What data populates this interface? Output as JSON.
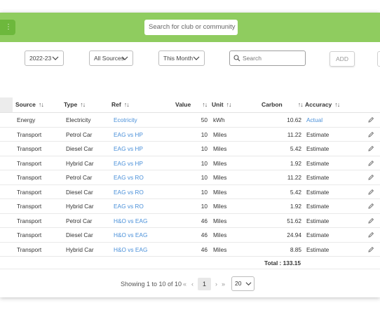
{
  "topbar": {
    "menu_label": "⋮",
    "club_search_placeholder": "Search for club or community"
  },
  "filters": {
    "year": "2022-23",
    "sources": "All Sources",
    "period": "This Month",
    "search_placeholder": "Search",
    "add_label": "ADD"
  },
  "table": {
    "headers": {
      "source": "Source",
      "type": "Type",
      "ref": "Ref",
      "value": "Value",
      "unit": "Unit",
      "carbon": "Carbon",
      "accuracy": "Accuracy"
    },
    "rows": [
      {
        "source": "Energy",
        "type": "Electricity",
        "ref": "Ecotricity",
        "value": "50",
        "unit": "kWh",
        "carbon": "10.62",
        "accuracy": "Actual"
      },
      {
        "source": "Transport",
        "type": "Petrol Car",
        "ref": "EAG vs HP",
        "value": "10",
        "unit": "Miles",
        "carbon": "11.22",
        "accuracy": "Estimate"
      },
      {
        "source": "Transport",
        "type": "Diesel Car",
        "ref": "EAG vs HP",
        "value": "10",
        "unit": "Miles",
        "carbon": "5.42",
        "accuracy": "Estimate"
      },
      {
        "source": "Transport",
        "type": "Hybrid Car",
        "ref": "EAG vs HP",
        "value": "10",
        "unit": "Miles",
        "carbon": "1.92",
        "accuracy": "Estimate"
      },
      {
        "source": "Transport",
        "type": "Petrol Car",
        "ref": "EAG vs RO",
        "value": "10",
        "unit": "Miles",
        "carbon": "11.22",
        "accuracy": "Estimate"
      },
      {
        "source": "Transport",
        "type": "Diesel Car",
        "ref": "EAG vs RO",
        "value": "10",
        "unit": "Miles",
        "carbon": "5.42",
        "accuracy": "Estimate"
      },
      {
        "source": "Transport",
        "type": "Hybrid Car",
        "ref": "EAG vs RO",
        "value": "10",
        "unit": "Miles",
        "carbon": "1.92",
        "accuracy": "Estimate"
      },
      {
        "source": "Transport",
        "type": "Petrol Car",
        "ref": "H&O vs EAG",
        "value": "46",
        "unit": "Miles",
        "carbon": "51.62",
        "accuracy": "Estimate"
      },
      {
        "source": "Transport",
        "type": "Diesel Car",
        "ref": "H&O vs EAG",
        "value": "46",
        "unit": "Miles",
        "carbon": "24.94",
        "accuracy": "Estimate"
      },
      {
        "source": "Transport",
        "type": "Hybrid Car",
        "ref": "H&O vs EAG",
        "value": "46",
        "unit": "Miles",
        "carbon": "8.85",
        "accuracy": "Estimate"
      }
    ],
    "total": "Total : 133.15"
  },
  "pagination": {
    "info": "Showing 1 to 10 of 10",
    "first": "«",
    "prev": "‹",
    "current_page": "1",
    "next": "›",
    "last": "»",
    "page_size": "20"
  },
  "colors": {
    "topbar": "#8fcc5f",
    "accent": "#6db83c",
    "link": "#4a90d9"
  }
}
